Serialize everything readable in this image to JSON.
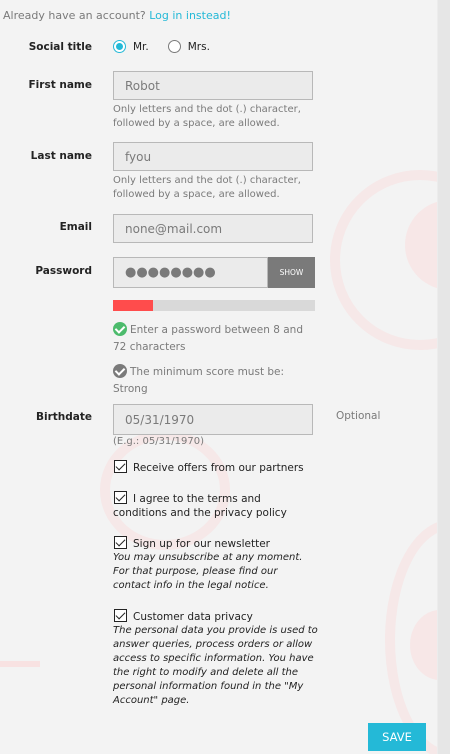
{
  "account_prompt": {
    "text": "Already have an account?",
    "link": "Log in instead!"
  },
  "social_title": {
    "label": "Social title",
    "options": [
      {
        "label": "Mr.",
        "checked": true
      },
      {
        "label": "Mrs.",
        "checked": false
      }
    ]
  },
  "first_name": {
    "label": "First name",
    "value": "Robot",
    "help": "Only letters and the dot (.) character, followed by a space, are allowed."
  },
  "last_name": {
    "label": "Last name",
    "value": "fyou",
    "help": "Only letters and the dot (.) character, followed by a space, are allowed."
  },
  "email": {
    "label": "Email",
    "value": "none@mail.com"
  },
  "password": {
    "label": "Password",
    "masked_value": "●●●●●●●●",
    "show_label": "SHOW",
    "strength_fraction": 0.2,
    "requirements": [
      {
        "icon": "check-circle-green-icon",
        "text": "Enter a password between 8 and 72 characters"
      },
      {
        "icon": "check-circle-grey-icon",
        "text": "The minimum score must be: Strong"
      }
    ]
  },
  "birthdate": {
    "label": "Birthdate",
    "value": "05/31/1970",
    "help": "(E.g.: 05/31/1970)",
    "optional": "Optional"
  },
  "checkboxes": [
    {
      "label": "Receive offers from our partners",
      "note": ""
    },
    {
      "label": "I agree to the terms and conditions and the privacy policy",
      "note": ""
    },
    {
      "label": "Sign up for our newsletter",
      "note": "You may unsubscribe at any moment. For that purpose, please find our contact info in the legal notice."
    },
    {
      "label": "Customer data privacy",
      "note": "The personal data you provide is used to answer queries, process orders or allow access to specific information. You have the right to modify and delete all the personal information found in the \"My Account\" page."
    }
  ],
  "save_label": "SAVE",
  "colors": {
    "accent": "#24b9d7",
    "strength_weak": "#ff4c4c",
    "success": "#4cbb6c",
    "muted": "#7a7a7a"
  }
}
